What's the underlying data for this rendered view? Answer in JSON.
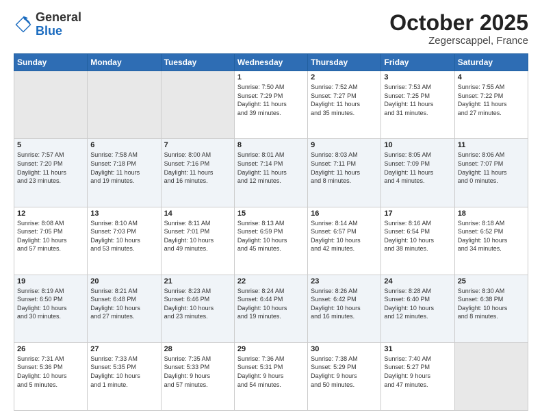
{
  "header": {
    "logo_general": "General",
    "logo_blue": "Blue",
    "month_title": "October 2025",
    "location": "Zegerscappel, France"
  },
  "days_of_week": [
    "Sunday",
    "Monday",
    "Tuesday",
    "Wednesday",
    "Thursday",
    "Friday",
    "Saturday"
  ],
  "weeks": [
    [
      {
        "day": "",
        "info": ""
      },
      {
        "day": "",
        "info": ""
      },
      {
        "day": "",
        "info": ""
      },
      {
        "day": "1",
        "info": "Sunrise: 7:50 AM\nSunset: 7:29 PM\nDaylight: 11 hours\nand 39 minutes."
      },
      {
        "day": "2",
        "info": "Sunrise: 7:52 AM\nSunset: 7:27 PM\nDaylight: 11 hours\nand 35 minutes."
      },
      {
        "day": "3",
        "info": "Sunrise: 7:53 AM\nSunset: 7:25 PM\nDaylight: 11 hours\nand 31 minutes."
      },
      {
        "day": "4",
        "info": "Sunrise: 7:55 AM\nSunset: 7:22 PM\nDaylight: 11 hours\nand 27 minutes."
      }
    ],
    [
      {
        "day": "5",
        "info": "Sunrise: 7:57 AM\nSunset: 7:20 PM\nDaylight: 11 hours\nand 23 minutes."
      },
      {
        "day": "6",
        "info": "Sunrise: 7:58 AM\nSunset: 7:18 PM\nDaylight: 11 hours\nand 19 minutes."
      },
      {
        "day": "7",
        "info": "Sunrise: 8:00 AM\nSunset: 7:16 PM\nDaylight: 11 hours\nand 16 minutes."
      },
      {
        "day": "8",
        "info": "Sunrise: 8:01 AM\nSunset: 7:14 PM\nDaylight: 11 hours\nand 12 minutes."
      },
      {
        "day": "9",
        "info": "Sunrise: 8:03 AM\nSunset: 7:11 PM\nDaylight: 11 hours\nand 8 minutes."
      },
      {
        "day": "10",
        "info": "Sunrise: 8:05 AM\nSunset: 7:09 PM\nDaylight: 11 hours\nand 4 minutes."
      },
      {
        "day": "11",
        "info": "Sunrise: 8:06 AM\nSunset: 7:07 PM\nDaylight: 11 hours\nand 0 minutes."
      }
    ],
    [
      {
        "day": "12",
        "info": "Sunrise: 8:08 AM\nSunset: 7:05 PM\nDaylight: 10 hours\nand 57 minutes."
      },
      {
        "day": "13",
        "info": "Sunrise: 8:10 AM\nSunset: 7:03 PM\nDaylight: 10 hours\nand 53 minutes."
      },
      {
        "day": "14",
        "info": "Sunrise: 8:11 AM\nSunset: 7:01 PM\nDaylight: 10 hours\nand 49 minutes."
      },
      {
        "day": "15",
        "info": "Sunrise: 8:13 AM\nSunset: 6:59 PM\nDaylight: 10 hours\nand 45 minutes."
      },
      {
        "day": "16",
        "info": "Sunrise: 8:14 AM\nSunset: 6:57 PM\nDaylight: 10 hours\nand 42 minutes."
      },
      {
        "day": "17",
        "info": "Sunrise: 8:16 AM\nSunset: 6:54 PM\nDaylight: 10 hours\nand 38 minutes."
      },
      {
        "day": "18",
        "info": "Sunrise: 8:18 AM\nSunset: 6:52 PM\nDaylight: 10 hours\nand 34 minutes."
      }
    ],
    [
      {
        "day": "19",
        "info": "Sunrise: 8:19 AM\nSunset: 6:50 PM\nDaylight: 10 hours\nand 30 minutes."
      },
      {
        "day": "20",
        "info": "Sunrise: 8:21 AM\nSunset: 6:48 PM\nDaylight: 10 hours\nand 27 minutes."
      },
      {
        "day": "21",
        "info": "Sunrise: 8:23 AM\nSunset: 6:46 PM\nDaylight: 10 hours\nand 23 minutes."
      },
      {
        "day": "22",
        "info": "Sunrise: 8:24 AM\nSunset: 6:44 PM\nDaylight: 10 hours\nand 19 minutes."
      },
      {
        "day": "23",
        "info": "Sunrise: 8:26 AM\nSunset: 6:42 PM\nDaylight: 10 hours\nand 16 minutes."
      },
      {
        "day": "24",
        "info": "Sunrise: 8:28 AM\nSunset: 6:40 PM\nDaylight: 10 hours\nand 12 minutes."
      },
      {
        "day": "25",
        "info": "Sunrise: 8:30 AM\nSunset: 6:38 PM\nDaylight: 10 hours\nand 8 minutes."
      }
    ],
    [
      {
        "day": "26",
        "info": "Sunrise: 7:31 AM\nSunset: 5:36 PM\nDaylight: 10 hours\nand 5 minutes."
      },
      {
        "day": "27",
        "info": "Sunrise: 7:33 AM\nSunset: 5:35 PM\nDaylight: 10 hours\nand 1 minute."
      },
      {
        "day": "28",
        "info": "Sunrise: 7:35 AM\nSunset: 5:33 PM\nDaylight: 9 hours\nand 57 minutes."
      },
      {
        "day": "29",
        "info": "Sunrise: 7:36 AM\nSunset: 5:31 PM\nDaylight: 9 hours\nand 54 minutes."
      },
      {
        "day": "30",
        "info": "Sunrise: 7:38 AM\nSunset: 5:29 PM\nDaylight: 9 hours\nand 50 minutes."
      },
      {
        "day": "31",
        "info": "Sunrise: 7:40 AM\nSunset: 5:27 PM\nDaylight: 9 hours\nand 47 minutes."
      },
      {
        "day": "",
        "info": ""
      }
    ]
  ]
}
